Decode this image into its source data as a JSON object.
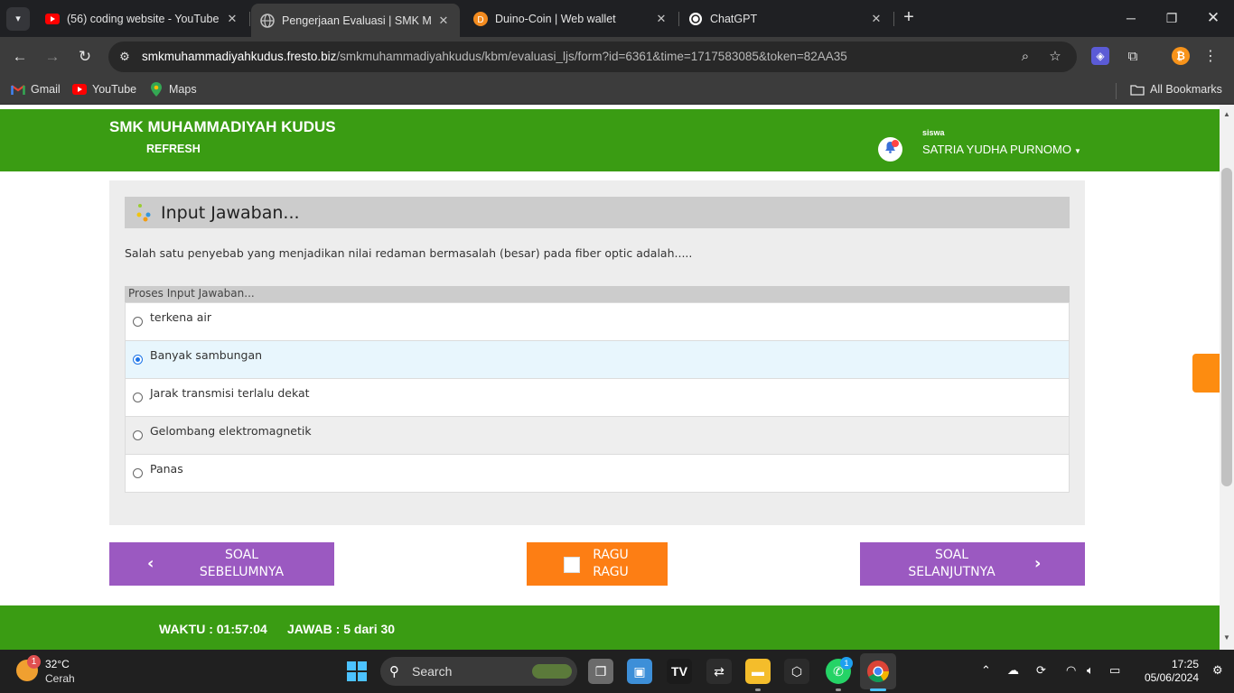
{
  "browser": {
    "tabs": [
      {
        "title": "(56) coding website - YouTube",
        "active": false
      },
      {
        "title": "Pengerjaan Evaluasi | SMK MUH",
        "active": true
      },
      {
        "title": "Duino-Coin | Web wallet",
        "active": false
      },
      {
        "title": "ChatGPT",
        "active": false
      }
    ],
    "url_host": "smkmuhammadiyahkudus.fresto.biz",
    "url_path": "/smkmuhammadiyahkudus/kbm/evaluasi_ljs/form?id=6361&time=1717583085&token=82AA35",
    "bookmarks": [
      "Gmail",
      "YouTube",
      "Maps"
    ],
    "all_bookmarks": "All Bookmarks"
  },
  "header": {
    "school": "SMK MUHAMMADIYAH KUDUS",
    "refresh": "REFRESH",
    "role": "siswa",
    "user": "SATRIA YUDHA PURNOMO"
  },
  "panel": {
    "title": "Input Jawaban...",
    "question": "Salah satu penyebab yang menjadikan nilai redaman bermasalah (besar) pada fiber optic adalah.....",
    "proses": "Proses Input Jawaban...",
    "options": [
      {
        "label": "terkena air",
        "selected": false
      },
      {
        "label": "Banyak sambungan",
        "selected": true
      },
      {
        "label": "Jarak transmisi terlalu dekat",
        "selected": false
      },
      {
        "label": "Gelombang elektromagnetik",
        "selected": false
      },
      {
        "label": "Panas",
        "selected": false
      }
    ]
  },
  "nav": {
    "prev_line1": "SOAL",
    "prev_line2": "SEBELUMNYA",
    "ragu_line1": "RAGU",
    "ragu_line2": "RAGU",
    "next_line1": "SOAL",
    "next_line2": "SELANJUTNYA"
  },
  "footer": {
    "waktu": "WAKTU : 01:57:04",
    "jawab": "JAWAB : 5 dari 30"
  },
  "colors": {
    "brand_green": "#3a9c13",
    "nav_purple": "#9b59c1",
    "ragu_orange": "#fd7e14",
    "selected_bg": "#e8f6fd"
  },
  "taskbar": {
    "temp": "32°C",
    "condition": "Cerah",
    "weather_badge": "1",
    "search": "Search",
    "whatsapp_badge": "1",
    "time": "17:25",
    "date": "05/06/2024"
  }
}
